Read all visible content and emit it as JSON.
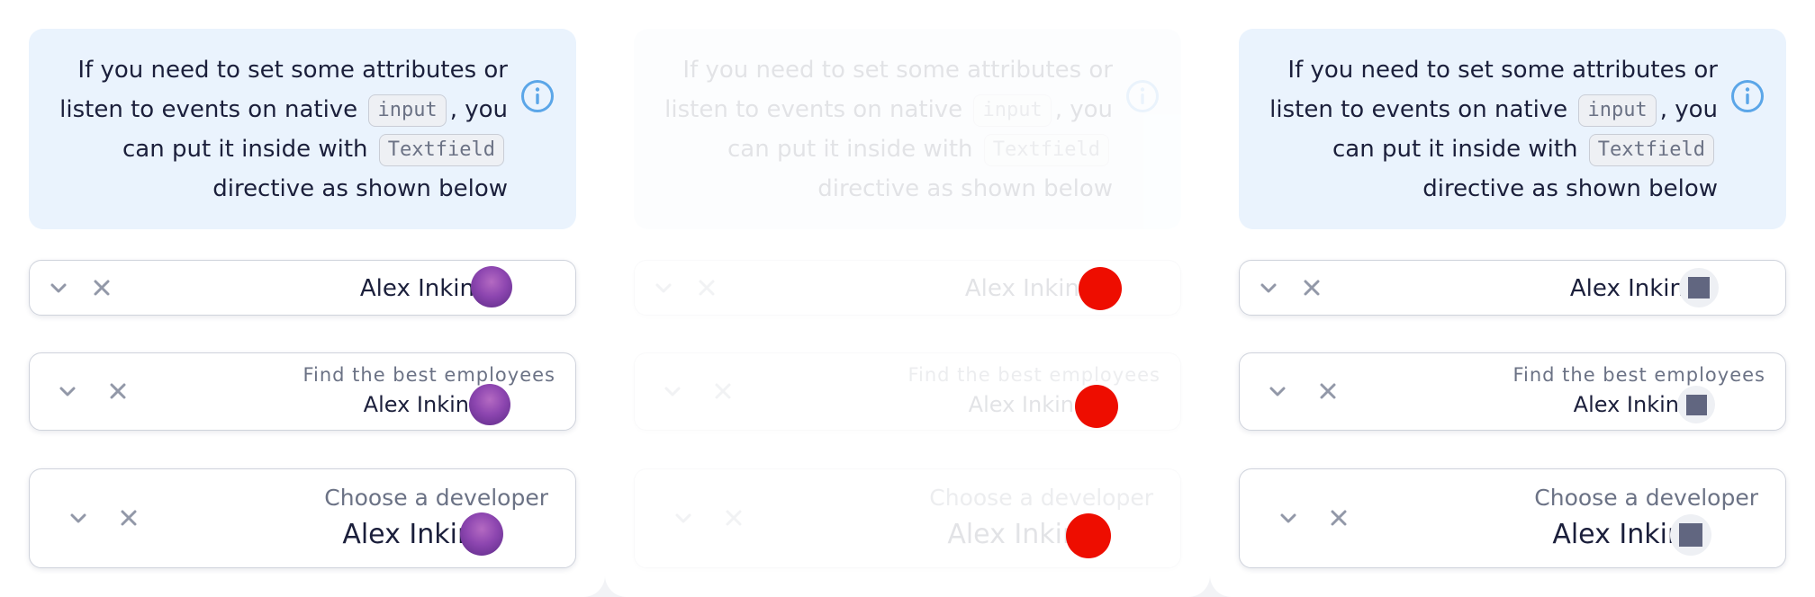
{
  "notice": {
    "line1": "If you need to set some attributes or",
    "line2_prefix": "listen to events on native",
    "line2_code": "input",
    "line2_suffix": ", you",
    "line3_prefix": "can put it inside with",
    "line3_code": "Textfield",
    "line4": "directive as shown below",
    "icon": "info-icon"
  },
  "field_small": {
    "value": "Alex Inkin"
  },
  "field_medium": {
    "label": "Find the best employees",
    "value": "Alex Inkin"
  },
  "field_large": {
    "label": "Choose a developer",
    "value": "Alex Inkin"
  },
  "icons": {
    "expand": "chevron-down-icon",
    "clear": "close-icon"
  },
  "colors": {
    "notice_bg": "#eaf3fd",
    "info_icon": "#5ba6e8",
    "text": "#1b1f3b",
    "label": "#6b7285",
    "border": "#cfd3dc",
    "avatar_fallback": "#616680",
    "avatar_error": "#ee0d00"
  }
}
